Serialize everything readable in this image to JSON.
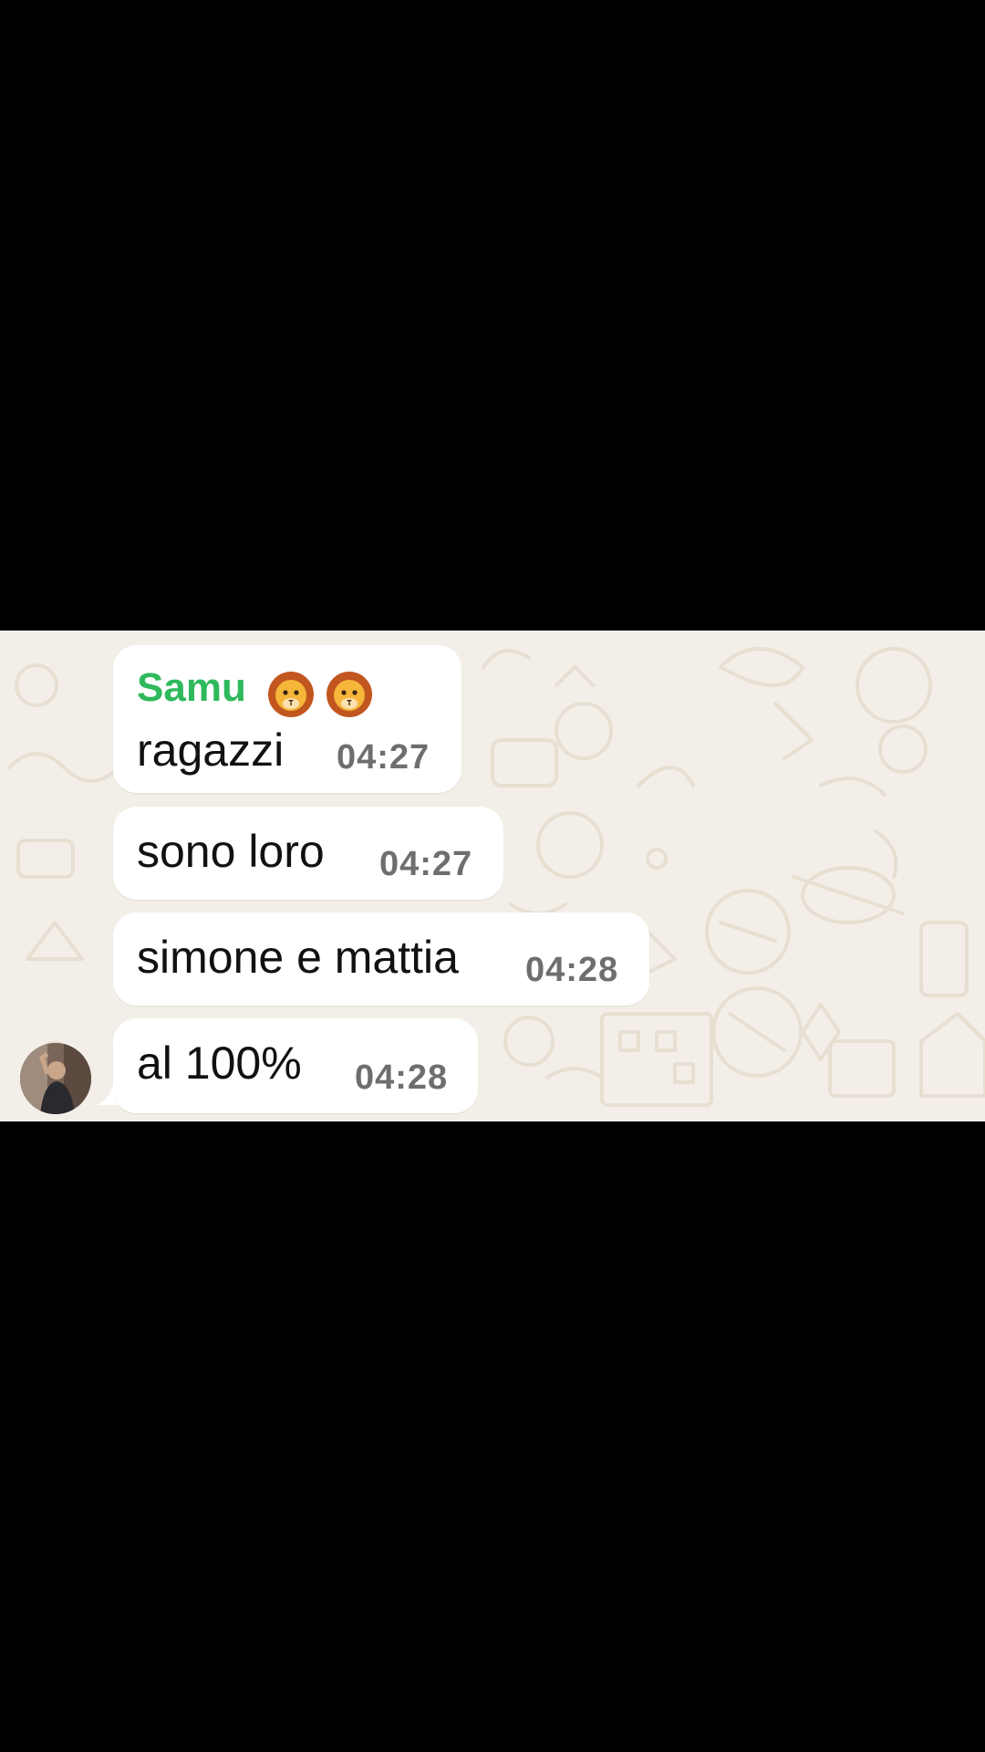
{
  "messages": [
    {
      "sender": "Samu",
      "sender_emoji": "lion-face-icon",
      "text": "ragazzi",
      "time": "04:27"
    },
    {
      "text": "sono loro",
      "time": "04:27"
    },
    {
      "text": "simone e mattia",
      "time": "04:28"
    },
    {
      "text": "al 100%",
      "time": "04:28"
    }
  ],
  "colors": {
    "sender_name": "#2fb95c",
    "bubble": "#ffffff",
    "wallpaper": "#f3efe8",
    "timestamp": "#6e6e6e",
    "letterbox": "#000000"
  },
  "icons": [
    "lion-face-icon",
    "avatar"
  ]
}
